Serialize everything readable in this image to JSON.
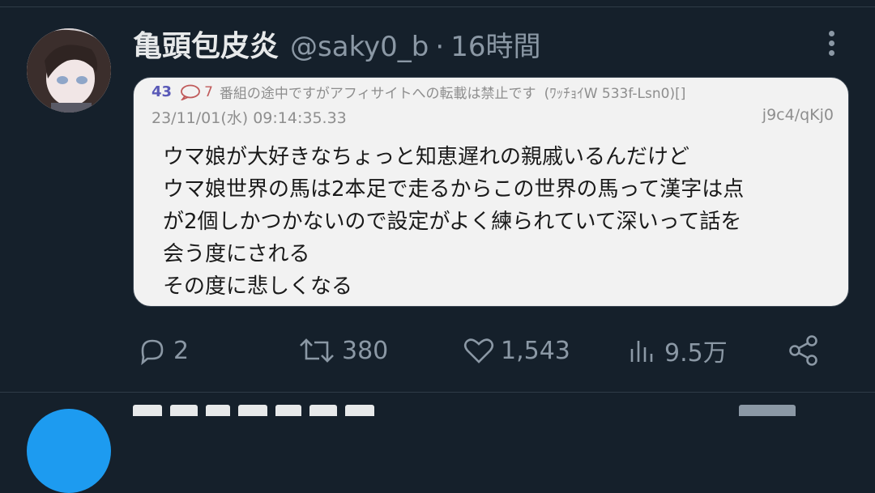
{
  "tweet": {
    "display_name": "亀頭包皮炎",
    "handle": "@saky0_b",
    "separator": "·",
    "time_ago": "16時間",
    "more_icon": "more-vertical-icon"
  },
  "embedded_post": {
    "res_number": "43",
    "reply_count": "7",
    "subject": "番組の途中ですがアフィサイトへの転載は禁止です",
    "poster_name": "(ﾜｯﾁｮｲW 533f-Lsn0)[]",
    "datetime": "23/11/01(水) 09:14:35.33",
    "poster_id": "j9c4/qKj0",
    "body_lines": [
      "ウマ娘が大好きなちょっと知恵遅れの親戚いるんだけど",
      "ウマ娘世界の馬は2本足で走るからこの世界の馬って漢字は点",
      "が2個しかつかないので設定がよく練られていて深いって話を",
      "会う度にされる",
      "その度に悲しくなる"
    ]
  },
  "actions": {
    "reply_count": "2",
    "retweet_count": "380",
    "like_count": "1,543",
    "view_count": "9.5万"
  },
  "colors": {
    "background": "#15202b",
    "primary_text": "#e7e9ea",
    "secondary_text": "#8b98a5",
    "card_background": "#f2f2f2"
  }
}
